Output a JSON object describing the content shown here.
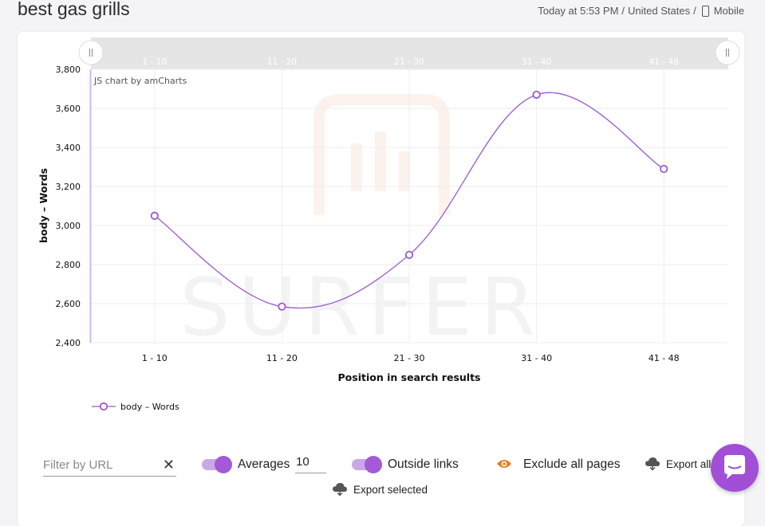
{
  "page": {
    "title": "best gas grills",
    "time": "Today at 5:53 PM",
    "location": "United States",
    "device": "Mobile",
    "sep1": "/",
    "sep2": "/"
  },
  "chart_data": {
    "type": "line",
    "categories": [
      "1 - 10",
      "11 - 20",
      "21 - 30",
      "31 - 40",
      "41 - 48"
    ],
    "series": [
      {
        "name": "body – Words",
        "values": [
          3050,
          2585,
          2850,
          3670,
          3290
        ]
      }
    ],
    "xlabel": "Position in search results",
    "ylabel": "body – Words",
    "ylim": [
      2400,
      3800
    ],
    "yticks": [
      "2,400",
      "2,600",
      "2,800",
      "3,000",
      "3,200",
      "3,400",
      "3,600",
      "3,800"
    ],
    "grid": true,
    "legend": "bottom-left",
    "credit": "JS chart by amCharts",
    "watermark": "SURFER",
    "scrollbar_labels": [
      "1 - 10",
      "11 - 20",
      "21 - 30",
      "31 - 40",
      "41 - 48"
    ],
    "color": "#9b59d0"
  },
  "controls": {
    "filter_placeholder": "Filter by URL",
    "clear_symbol": "✕",
    "averages_label": "Averages",
    "averages_value": "10",
    "outside_links_label": "Outside links",
    "exclude_label": "Exclude all pages",
    "export_all_label": "Export all",
    "export_selected_label": "Export selected"
  },
  "colors": {
    "accent": "#a35ad6",
    "toggle_track": "#c9a8e6",
    "eye": "#e67e22"
  }
}
